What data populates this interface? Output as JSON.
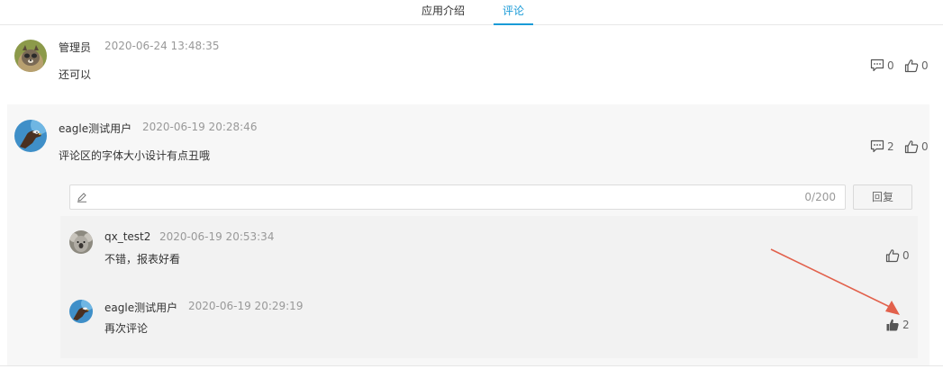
{
  "tabs": [
    {
      "label": "应用介绍",
      "active": false
    },
    {
      "label": "评论",
      "active": true
    }
  ],
  "comments": [
    {
      "author": "管理员",
      "time": "2020-06-24 13:48:35",
      "text": "还可以",
      "reply_count": "0",
      "like_count": "0",
      "avatar_icon": "raccoon-avatar"
    },
    {
      "author": "eagle测试用户",
      "time": "2020-06-19 20:28:46",
      "text": "评论区的字体大小设计有点丑哦",
      "reply_count": "2",
      "like_count": "0",
      "avatar_icon": "eagle-avatar",
      "reply_box": {
        "value": "",
        "placeholder": "",
        "counter": "0/200",
        "button_label": "回复"
      },
      "replies": [
        {
          "author": "qx_test2",
          "time": "2020-06-19 20:53:34",
          "text": "不错，报表好看",
          "like_count": "0",
          "avatar_icon": "koala-avatar",
          "liked": false
        },
        {
          "author": "eagle测试用户",
          "time": "2020-06-19 20:29:19",
          "text": "再次评论",
          "like_count": "2",
          "avatar_icon": "eagle-avatar",
          "liked": true
        }
      ]
    }
  ],
  "annotation": {
    "arrow_color": "#e2614c"
  },
  "colors": {
    "accent": "#1a9bd7",
    "muted_text": "#999999"
  }
}
